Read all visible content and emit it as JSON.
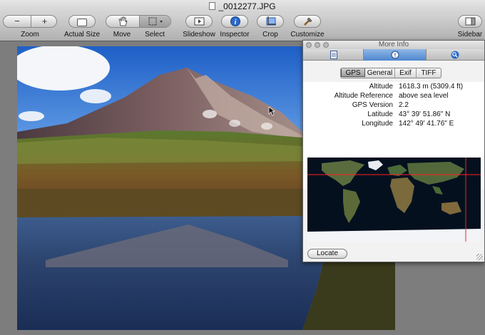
{
  "window": {
    "title": "_0012277.JPG"
  },
  "toolbar": {
    "zoom_label": "Zoom",
    "zoom_out_glyph": "−",
    "zoom_in_glyph": "+",
    "actual_size_label": "Actual Size",
    "move_label": "Move",
    "select_label": "Select",
    "slideshow_label": "Slideshow",
    "inspector_label": "Inspector",
    "crop_label": "Crop",
    "customize_label": "Customize",
    "sidebar_label": "Sidebar"
  },
  "inspector": {
    "title": "More Info",
    "tab_icons": [
      "document-icon",
      "info-icon",
      "magnifier-icon"
    ],
    "subtabs": [
      "GPS",
      "General",
      "Exif",
      "TIFF"
    ],
    "selected_subtab": "GPS",
    "rows": [
      {
        "key": "Altitude",
        "value": "1618.3 m (5309.4 ft)"
      },
      {
        "key": "Altitude Reference",
        "value": "above sea level"
      },
      {
        "key": "GPS Version",
        "value": "2.2"
      },
      {
        "key": "Latitude",
        "value": "43° 39' 51.86\" N"
      },
      {
        "key": "Longitude",
        "value": "142° 49' 41.76\" E"
      }
    ],
    "locate_label": "Locate"
  },
  "colors": {
    "selected_tab": "#4e86cf",
    "crosshair": "#ff2020"
  }
}
